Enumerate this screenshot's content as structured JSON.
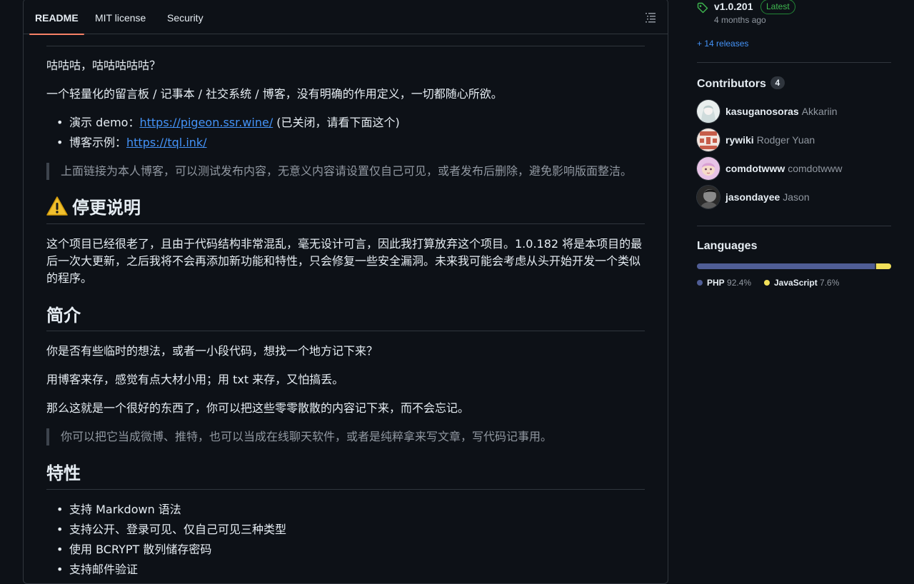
{
  "tabs": {
    "readme": "README",
    "license": "MIT license",
    "security": "Security"
  },
  "readme": {
    "intro": "咕咕咕，咕咕咕咕咕？",
    "description": "一个轻量化的留言板 / 记事本 / 社交系统 / 博客，没有明确的作用定义，一切都随心所欲。",
    "demo": {
      "prefix": "演示 demo：",
      "link": "https://pigeon.ssr.wine/",
      "suffix": " (已关闭，请看下面这个)"
    },
    "blog": {
      "prefix": "博客示例：",
      "link": "https://tql.ink/"
    },
    "quote1": "上面链接为本人博客，可以测试发布内容，无意义内容请设置仅自己可见，或者发布后删除，避免影响版面整洁。",
    "h_deprecation": "停更说明",
    "deprecation_text": "这个项目已经很老了，且由于代码结构非常混乱，毫无设计可言，因此我打算放弃这个项目。1.0.182 将是本项目的最后一次大更新，之后我将不会再添加新功能和特性，只会修复一些安全漏洞。未来我可能会考虑从头开始开发一个类似的程序。",
    "h_intro": "简介",
    "intro_p1": "你是否有些临时的想法，或者一小段代码，想找一个地方记下来？",
    "intro_p2": "用博客来存，感觉有点大材小用；用 txt 来存，又怕搞丢。",
    "intro_p3": "那么这就是一个很好的东西了，你可以把这些零零散散的内容记下来，而不会忘记。",
    "quote2": "你可以把它当成微博、推特，也可以当成在线聊天软件，或者是纯粹拿来写文章，写代码记事用。",
    "h_features": "特性",
    "features": [
      "支持 Markdown 语法",
      "支持公开、登录可见、仅自己可见三种类型",
      "使用 BCRYPT 散列储存密码",
      "支持邮件验证"
    ]
  },
  "sidebar": {
    "release": {
      "version": "v1.0.201",
      "badge": "Latest",
      "time": "4 months ago",
      "more": "+ 14 releases"
    },
    "contributors": {
      "title": "Contributors",
      "count": "4",
      "list": [
        {
          "login": "kasuganosoras",
          "name": "Akkariin"
        },
        {
          "login": "rywiki",
          "name": "Rodger Yuan"
        },
        {
          "login": "comdotwww",
          "name": "comdotwww"
        },
        {
          "login": "jasondayee",
          "name": "Jason"
        }
      ]
    },
    "languages": {
      "title": "Languages",
      "items": [
        {
          "name": "PHP",
          "percent": "92.4%",
          "fraction": 0.924,
          "color": "#4F5D95"
        },
        {
          "name": "JavaScript",
          "percent": "7.6%",
          "fraction": 0.076,
          "color": "#f1e05a"
        }
      ]
    }
  },
  "colors": {
    "background": "#0d1117",
    "border": "#30363d",
    "link": "#4493f8",
    "tab_underline": "#f78166",
    "latest_green": "#3fb950"
  }
}
